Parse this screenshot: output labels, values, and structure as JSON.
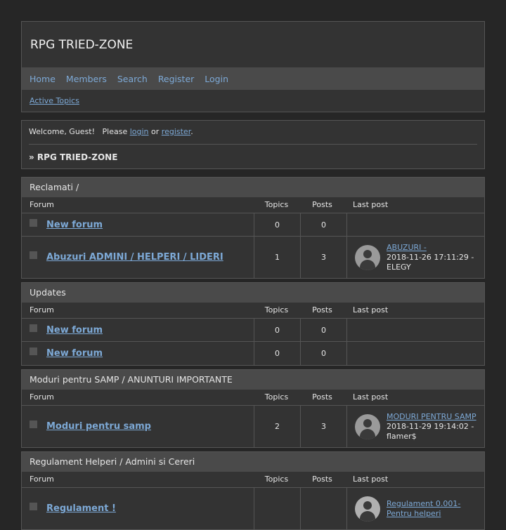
{
  "site": {
    "title": "RPG TRIED-ZONE"
  },
  "nav": [
    "Home",
    "Members",
    "Search",
    "Register",
    "Login"
  ],
  "subnav": {
    "active_topics": "Active Topics"
  },
  "welcome": {
    "greeting": "Welcome, Guest!",
    "please": "Please",
    "login": "login",
    "or": "or",
    "register": "register",
    "period": ".",
    "breadcrumb": "» RPG TRIED-ZONE"
  },
  "columns": {
    "forum": "Forum",
    "topics": "Topics",
    "posts": "Posts",
    "last_post": "Last post"
  },
  "categories": [
    {
      "title": "Reclamati /",
      "forums": [
        {
          "name": "New forum",
          "topics": "0",
          "posts": "0"
        },
        {
          "name": "Abuzuri ADMINI / HELPERI / LIDERI",
          "topics": "1",
          "posts": "3",
          "last": {
            "title": "ABUZURI -",
            "date": "2018-11-26 17:11:29",
            "sep": " - ",
            "user": "ELEGY"
          }
        }
      ]
    },
    {
      "title": "Updates",
      "forums": [
        {
          "name": "New forum",
          "topics": "0",
          "posts": "0"
        },
        {
          "name": "New forum",
          "topics": "0",
          "posts": "0"
        }
      ]
    },
    {
      "title": "Moduri pentru SAMP / ANUNTURI IMPORTANTE",
      "forums": [
        {
          "name": "Moduri pentru samp",
          "topics": "2",
          "posts": "3",
          "last": {
            "title": "MODURI PENTRU SAMP",
            "date": "2018-11-29 19:14:02",
            "sep": " - ",
            "user": "flamer$"
          }
        }
      ]
    },
    {
      "title": "Regulament Helperi / Admini si Cereri",
      "forums": [
        {
          "name": "Regulament !",
          "topics": "",
          "posts": "",
          "last": {
            "title": "Regulament 0.001- Pentru helperi",
            "date": "",
            "sep": "",
            "user": ""
          }
        }
      ]
    }
  ]
}
